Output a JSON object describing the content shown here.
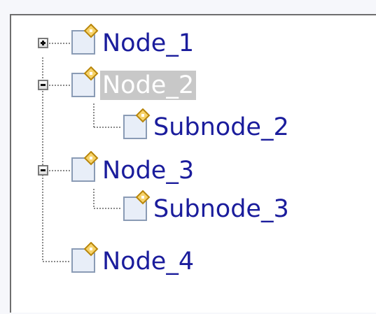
{
  "tree": {
    "nodes": [
      {
        "label": "Node_1",
        "state": "collapsed",
        "selected": false,
        "icon": "document-diamond-icon"
      },
      {
        "label": "Node_2",
        "state": "expanded",
        "selected": true,
        "icon": "document-diamond-icon",
        "children": [
          {
            "label": "Subnode_2",
            "icon": "document-diamond-icon"
          }
        ]
      },
      {
        "label": "Node_3",
        "state": "expanded",
        "selected": false,
        "icon": "document-diamond-icon",
        "children": [
          {
            "label": "Subnode_3",
            "icon": "document-diamond-icon"
          }
        ]
      },
      {
        "label": "Node_4",
        "state": "leaf",
        "selected": false,
        "icon": "document-diamond-icon"
      }
    ]
  },
  "colors": {
    "label_text": "#1a1c9c",
    "selection_bg": "#c8c8c8",
    "selection_text": "#ffffff",
    "connector": "#8a8a8a",
    "icon_diamond": "#e8b84a"
  }
}
